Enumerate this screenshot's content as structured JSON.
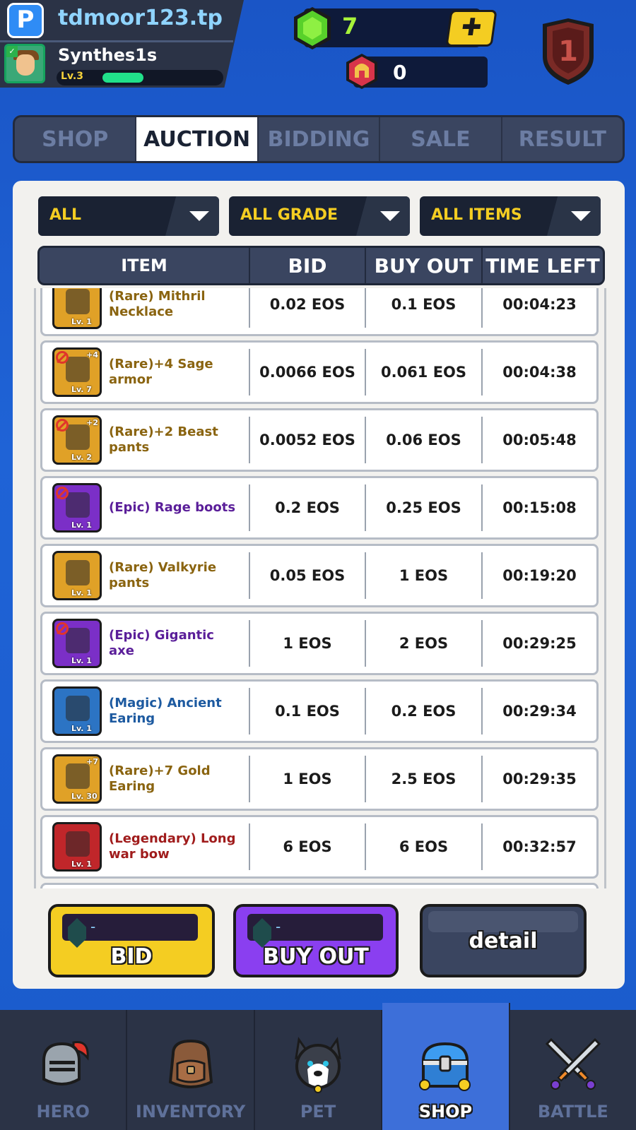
{
  "header": {
    "app_logo": "P",
    "username": "tdmoor123.tp",
    "player_name": "Synthes1s",
    "level": "Lv.3",
    "level_progress": 0.45,
    "gems": "7",
    "helm_points": "0",
    "rank": "1"
  },
  "tabs": [
    {
      "label": "SHOP",
      "active": false
    },
    {
      "label": "AUCTION",
      "active": true
    },
    {
      "label": "BIDDING",
      "active": false
    },
    {
      "label": "SALE",
      "active": false
    },
    {
      "label": "RESULT",
      "active": false
    }
  ],
  "filters": [
    "ALL",
    "ALL GRADE",
    "ALL ITEMS"
  ],
  "table": {
    "headers": [
      "ITEM",
      "BID",
      "BUY OUT",
      "TIME LEFT"
    ],
    "rows": [
      {
        "grade": "rare",
        "name": "(Rare) Mithril Necklace",
        "level": "Lv. 1",
        "plus": "",
        "banned": false,
        "bid": "0.02 EOS",
        "buyout": "0.1 EOS",
        "time": "00:04:23"
      },
      {
        "grade": "rare",
        "name": "(Rare)+4 Sage armor",
        "level": "Lv. 7",
        "plus": "+4",
        "banned": true,
        "bid": "0.0066 EOS",
        "buyout": "0.061 EOS",
        "time": "00:04:38"
      },
      {
        "grade": "rare",
        "name": "(Rare)+2 Beast pants",
        "level": "Lv. 2",
        "plus": "+2",
        "banned": true,
        "bid": "0.0052 EOS",
        "buyout": "0.06 EOS",
        "time": "00:05:48"
      },
      {
        "grade": "epic",
        "name": "(Epic) Rage boots",
        "level": "Lv. 1",
        "plus": "",
        "banned": true,
        "bid": "0.2 EOS",
        "buyout": "0.25 EOS",
        "time": "00:15:08"
      },
      {
        "grade": "rare",
        "name": "(Rare) Valkyrie pants",
        "level": "Lv. 1",
        "plus": "",
        "banned": false,
        "bid": "0.05 EOS",
        "buyout": "1 EOS",
        "time": "00:19:20"
      },
      {
        "grade": "epic",
        "name": "(Epic) Gigantic axe",
        "level": "Lv. 1",
        "plus": "",
        "banned": true,
        "bid": "1 EOS",
        "buyout": "2 EOS",
        "time": "00:29:25"
      },
      {
        "grade": "magic",
        "name": "(Magic) Ancient Earing",
        "level": "Lv. 1",
        "plus": "",
        "banned": false,
        "bid": "0.1 EOS",
        "buyout": "0.2 EOS",
        "time": "00:29:34"
      },
      {
        "grade": "rare",
        "name": "(Rare)+7 Gold Earing",
        "level": "Lv. 30",
        "plus": "+7",
        "banned": false,
        "bid": "1 EOS",
        "buyout": "2.5 EOS",
        "time": "00:29:35"
      },
      {
        "grade": "legendary",
        "name": "(Legendary) Long war bow",
        "level": "Lv. 1",
        "plus": "",
        "banned": false,
        "bid": "6 EOS",
        "buyout": "6 EOS",
        "time": "00:32:57"
      }
    ]
  },
  "actions": {
    "bid_price": "-",
    "bid_label": "BID",
    "buyout_price": "-",
    "buyout_label": "BUY OUT",
    "detail_label": "detail"
  },
  "nav": [
    {
      "label": "HERO",
      "icon": "knight-helmet-icon",
      "active": false
    },
    {
      "label": "INVENTORY",
      "icon": "backpack-icon",
      "active": false
    },
    {
      "label": "PET",
      "icon": "husky-pet-icon",
      "active": false
    },
    {
      "label": "SHOP",
      "icon": "treasure-chest-icon",
      "active": true
    },
    {
      "label": "BATTLE",
      "icon": "crossed-swords-icon",
      "active": false
    }
  ],
  "colors": {
    "background": "#1f63d6",
    "accent_yellow": "#f4cd22",
    "accent_purple": "#8a3ff0",
    "rare": "#8a6410",
    "epic": "#5a1e99",
    "magic": "#1d5aa0",
    "legendary": "#a01c1c"
  }
}
